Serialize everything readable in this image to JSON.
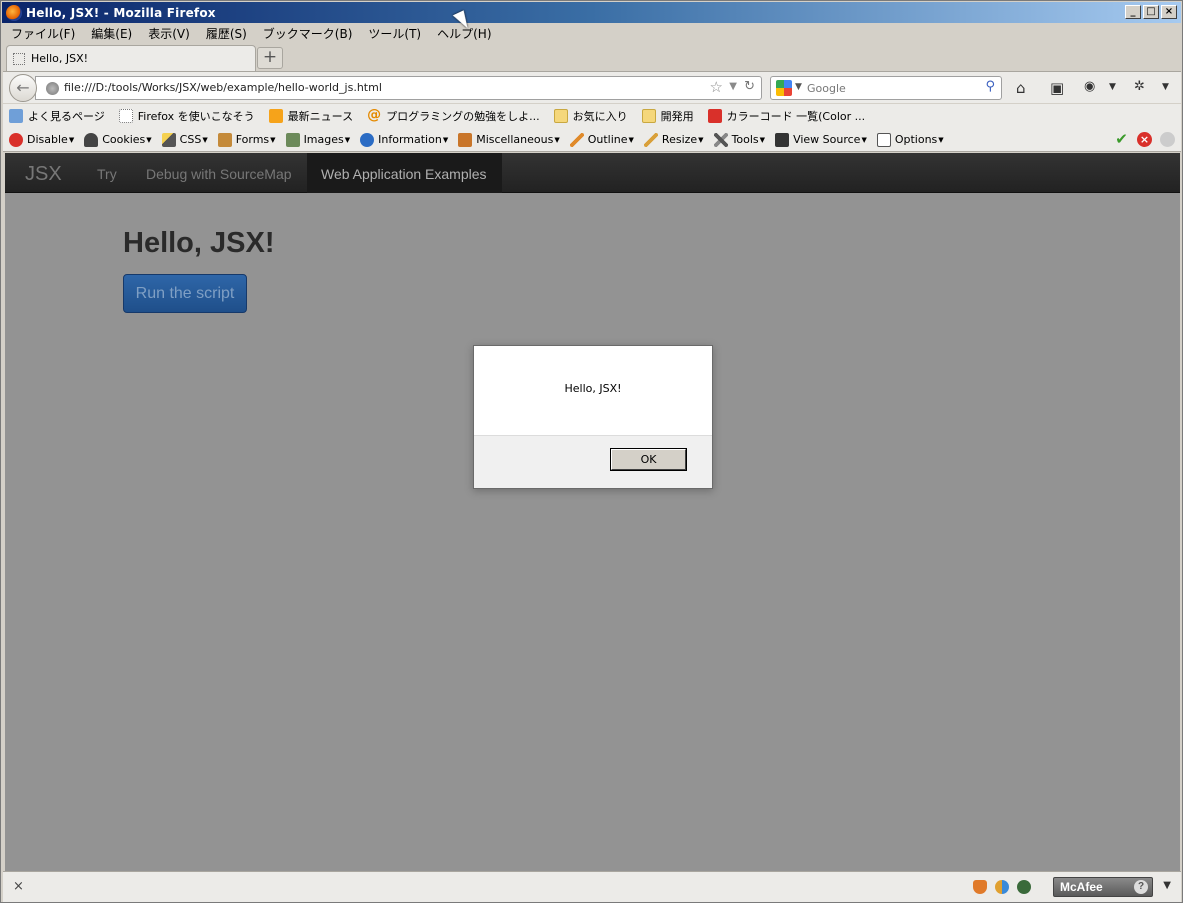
{
  "window": {
    "title": "Hello, JSX! - Mozilla Firefox",
    "buttons": [
      "_",
      "□",
      "×"
    ]
  },
  "menu": [
    "ファイル(F)",
    "編集(E)",
    "表示(V)",
    "履歴(S)",
    "ブックマーク(B)",
    "ツール(T)",
    "ヘルプ(H)"
  ],
  "tab": {
    "label": "Hello, JSX!",
    "new_tab": "+"
  },
  "nav": {
    "url": "file:///D:/tools/Works/JSX/web/example/hello-world_js.html",
    "search_placeholder": "Google"
  },
  "bookmarks": [
    {
      "label": "よく見るページ",
      "icon": "smart-bookmark-icon"
    },
    {
      "label": "Firefox を使いこなそう",
      "icon": "page-icon"
    },
    {
      "label": "最新ニュース",
      "icon": "rss-icon"
    },
    {
      "label": "プログラミングの勉強をしよ...",
      "icon": "at-icon"
    },
    {
      "label": "お気に入り",
      "icon": "folder-icon"
    },
    {
      "label": "開発用",
      "icon": "folder-icon"
    },
    {
      "label": "カラーコード 一覧(Color ...",
      "icon": "mario-icon"
    }
  ],
  "webdev_toolbar": [
    {
      "label": "Disable",
      "icon": "disable-icon"
    },
    {
      "label": "Cookies",
      "icon": "cookies-icon"
    },
    {
      "label": "CSS",
      "icon": "css-icon"
    },
    {
      "label": "Forms",
      "icon": "forms-icon"
    },
    {
      "label": "Images",
      "icon": "images-icon"
    },
    {
      "label": "Information",
      "icon": "information-icon"
    },
    {
      "label": "Miscellaneous",
      "icon": "miscellaneous-icon"
    },
    {
      "label": "Outline",
      "icon": "outline-icon"
    },
    {
      "label": "Resize",
      "icon": "resize-icon"
    },
    {
      "label": "Tools",
      "icon": "tools-icon"
    },
    {
      "label": "View Source",
      "icon": "view-source-icon"
    },
    {
      "label": "Options",
      "icon": "options-icon"
    }
  ],
  "site_nav": {
    "brand": "JSX",
    "links": [
      "Try",
      "Debug with SourceMap"
    ],
    "active": "Web Application Examples"
  },
  "page": {
    "heading": "Hello, JSX!",
    "button": "Run the script"
  },
  "dialog": {
    "message": "Hello, JSX!",
    "ok": "OK"
  },
  "status": {
    "close": "×",
    "mcafee": "McAfee",
    "help": "?"
  },
  "colors": {
    "navbar": "#222222",
    "button": "#1f4f8a",
    "overlay": "#939393"
  }
}
